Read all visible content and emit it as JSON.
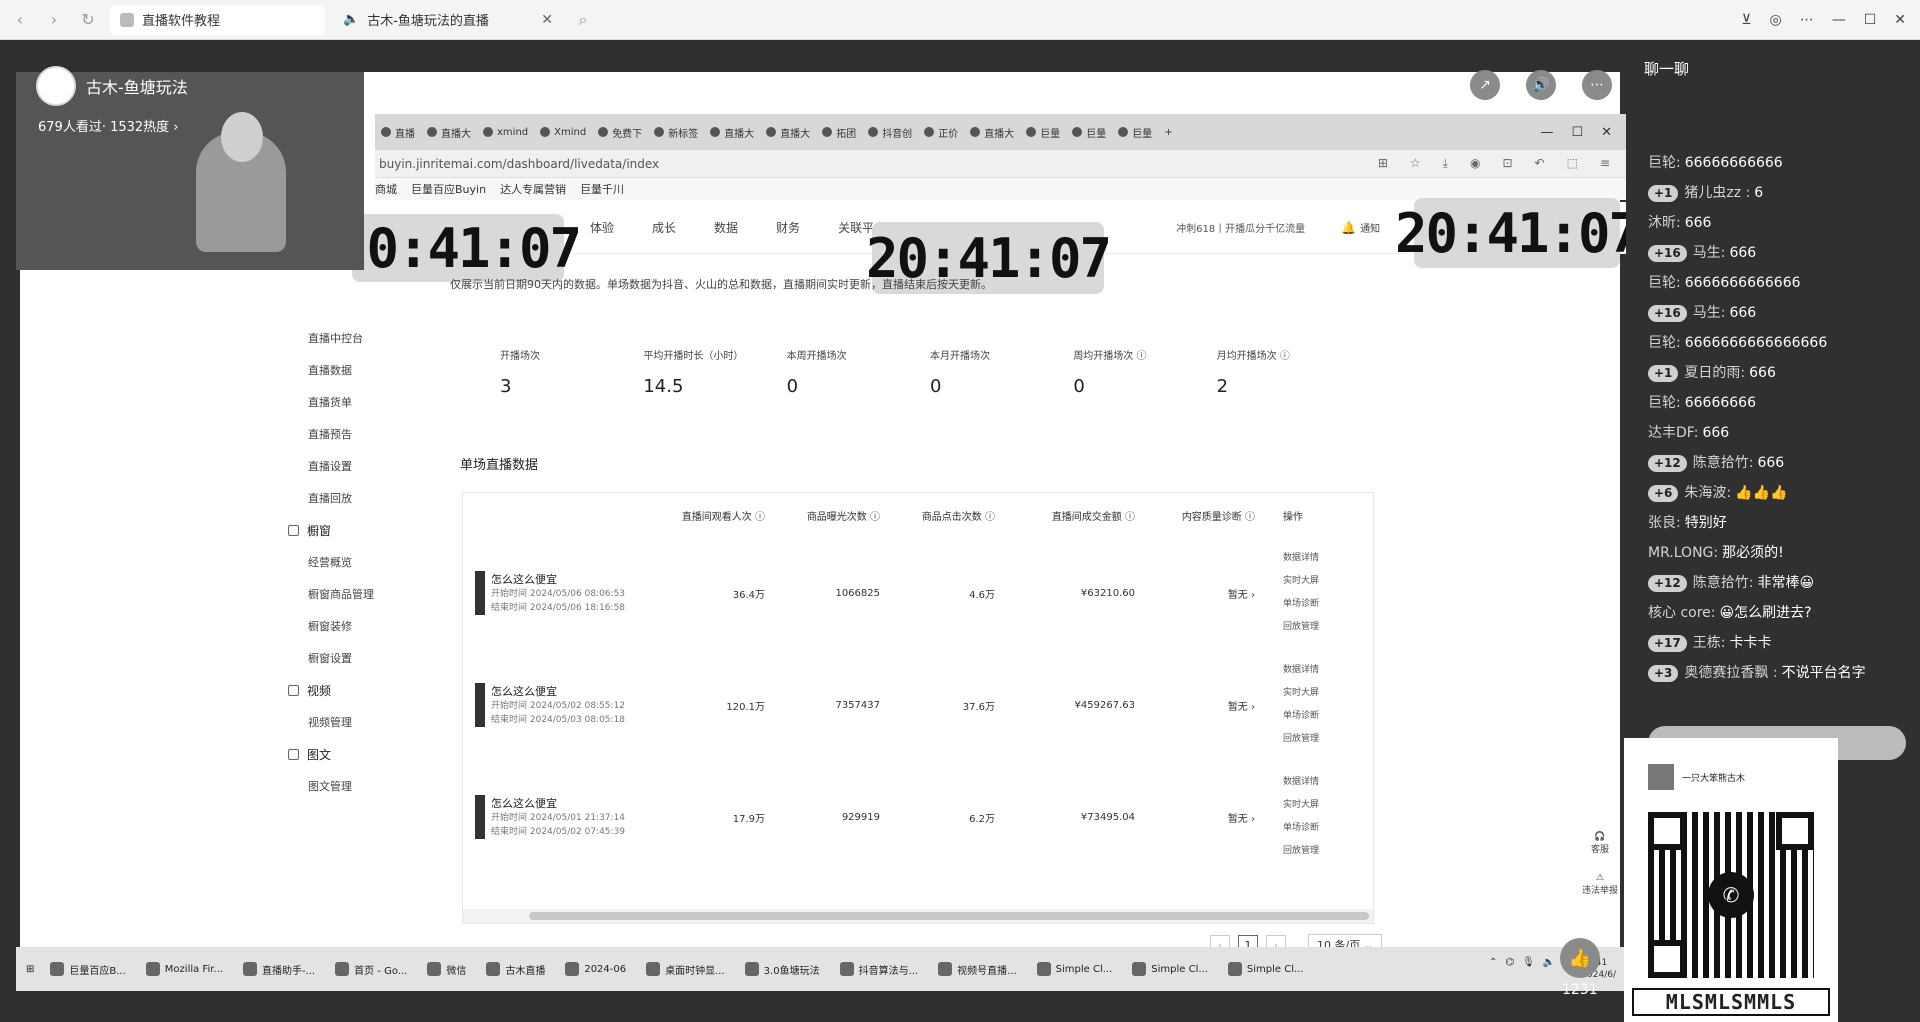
{
  "browser": {
    "tabs": [
      {
        "label": "直播软件教程"
      },
      {
        "label": "古木-鱼塘玩法的直播"
      }
    ]
  },
  "stream": {
    "anchor_name": "古木-鱼塘玩法",
    "viewers": "679人看过· 1532热度 ›",
    "like_count": "1231"
  },
  "inner_browser": {
    "tabs": [
      "直播",
      "直播大",
      "xmind",
      "Xmind",
      "免费下",
      "新标签",
      "直播大",
      "直播大",
      "拓团",
      "抖音创",
      "正价",
      "直播大",
      "巨量",
      "巨量",
      "巨量"
    ],
    "url": "buyin.jinritemai.com/dashboard/livedata/index",
    "bookmarks": [
      "商城",
      "巨量百应Buyin",
      "达人专属营销",
      "巨量千川"
    ]
  },
  "dashboard": {
    "nav": [
      "体验",
      "成长",
      "数据",
      "财务",
      "关联平台"
    ],
    "promo": "冲刺618丨开播瓜分千亿流量",
    "notify": "通知",
    "clock": "20:41:07",
    "notice": "仅展示当前日期90天内的数据。单场数据为抖音、火山的总和数据，直播期间实时更新，直播结束后按天更新。",
    "sidebar": [
      {
        "label": "直播中控台",
        "group": false
      },
      {
        "label": "直播数据",
        "group": false
      },
      {
        "label": "直播货单",
        "group": false
      },
      {
        "label": "直播预告",
        "group": false
      },
      {
        "label": "直播设置",
        "group": false
      },
      {
        "label": "直播回放",
        "group": false
      },
      {
        "label": "橱窗",
        "group": true
      },
      {
        "label": "经营概览",
        "group": false
      },
      {
        "label": "橱窗商品管理",
        "group": false
      },
      {
        "label": "橱窗装修",
        "group": false
      },
      {
        "label": "橱窗设置",
        "group": false
      },
      {
        "label": "视频",
        "group": true
      },
      {
        "label": "视频管理",
        "group": false
      },
      {
        "label": "图文",
        "group": true
      },
      {
        "label": "图文管理",
        "group": false
      }
    ],
    "stats": [
      {
        "label": "开播场次",
        "value": "3"
      },
      {
        "label": "平均开播时长（小时）",
        "value": "14.5"
      },
      {
        "label": "本周开播场次",
        "value": "0"
      },
      {
        "label": "本月开播场次",
        "value": "0"
      },
      {
        "label": "周均开播场次 ⓘ",
        "value": "0"
      },
      {
        "label": "月均开播场次 ⓘ",
        "value": "2"
      }
    ],
    "section_title": "单场直播数据",
    "columns": [
      "",
      "直播间观看人次 ⓘ",
      "商品曝光次数 ⓘ",
      "商品点击次数 ⓘ",
      "直播间成交金额 ⓘ",
      "内容质量诊断 ⓘ",
      "操作"
    ],
    "rows": [
      {
        "name": "怎么这么便宜",
        "start": "开始时间   2024/05/06 08:06:53",
        "end": "结束时间   2024/05/06 18:16:58",
        "views": "36.4万",
        "exposure": "1066825",
        "clicks": "4.6万",
        "gmv": "¥63210.60",
        "diag": "暂无 ›"
      },
      {
        "name": "怎么这么便宜",
        "start": "开始时间   2024/05/02 08:55:12",
        "end": "结束时间   2024/05/03 08:05:18",
        "views": "120.1万",
        "exposure": "7357437",
        "clicks": "37.6万",
        "gmv": "¥459267.63",
        "diag": "暂无 ›"
      },
      {
        "name": "怎么这么便宜",
        "start": "开始时间   2024/05/01 21:37:14",
        "end": "结束时间   2024/05/02 07:45:39",
        "views": "17.9万",
        "exposure": "929919",
        "clicks": "6.2万",
        "gmv": "¥73495.04",
        "diag": "暂无 ›"
      }
    ],
    "ops": [
      "数据详情",
      "实时大屏",
      "单场诊断",
      "回放管理"
    ],
    "page": "1",
    "page_size": "10 条/页",
    "service": "客服",
    "report": "违法举报"
  },
  "taskbar": [
    "巨量百应B...",
    "Mozilla Fir...",
    "直播助手-...",
    "首页 - Go...",
    "微信",
    "古木直播",
    "2024-06",
    "桌面时钟显...",
    "3.0鱼塘玩法",
    "抖音算法与...",
    "视频号直播...",
    "Simple Cl...",
    "Simple Cl...",
    "Simple Cl..."
  ],
  "tray_time": "20:41",
  "tray_date": "2024/6/",
  "chat": {
    "title": "聊一聊",
    "messages": [
      {
        "badge": "",
        "user": "巨轮:",
        "text": "66666666666"
      },
      {
        "badge": "1",
        "user": "猪儿虫zz    :",
        "text": "6"
      },
      {
        "badge": "",
        "user": "沐昕:",
        "text": "666"
      },
      {
        "badge": "16",
        "user": "马生:",
        "text": "666"
      },
      {
        "badge": "",
        "user": "巨轮:",
        "text": "6666666666666"
      },
      {
        "badge": "16",
        "user": "马生:",
        "text": "666"
      },
      {
        "badge": "",
        "user": "巨轮:",
        "text": "6666666666666666"
      },
      {
        "badge": "1",
        "user": "夏日的雨:",
        "text": "666"
      },
      {
        "badge": "",
        "user": "巨轮:",
        "text": "66666666"
      },
      {
        "badge": "",
        "user": "达丰DF:",
        "text": "666"
      },
      {
        "badge": "12",
        "user": "陈意拾竹:",
        "text": "666"
      },
      {
        "badge": "6",
        "user": "朱海波:",
        "text": "👍👍👍"
      },
      {
        "badge": "",
        "user": "张良:",
        "text": "特别好"
      },
      {
        "badge": "",
        "user": "MR.LONG:",
        "text": "那必须的!"
      },
      {
        "badge": "12",
        "user": "陈意拾竹:",
        "text": "非常棒😀"
      },
      {
        "badge": "",
        "user": "核心 core:",
        "text": "😀怎么刷进去?"
      },
      {
        "badge": "17",
        "user": "王栋:",
        "text": "卡卡卡"
      },
      {
        "badge": "3",
        "user": "奥德赛拉香飘    :",
        "text": "不说平台名字"
      }
    ]
  },
  "qr": {
    "name": "一只大笨熊古木",
    "footer": "MLSMLSMMLS"
  }
}
